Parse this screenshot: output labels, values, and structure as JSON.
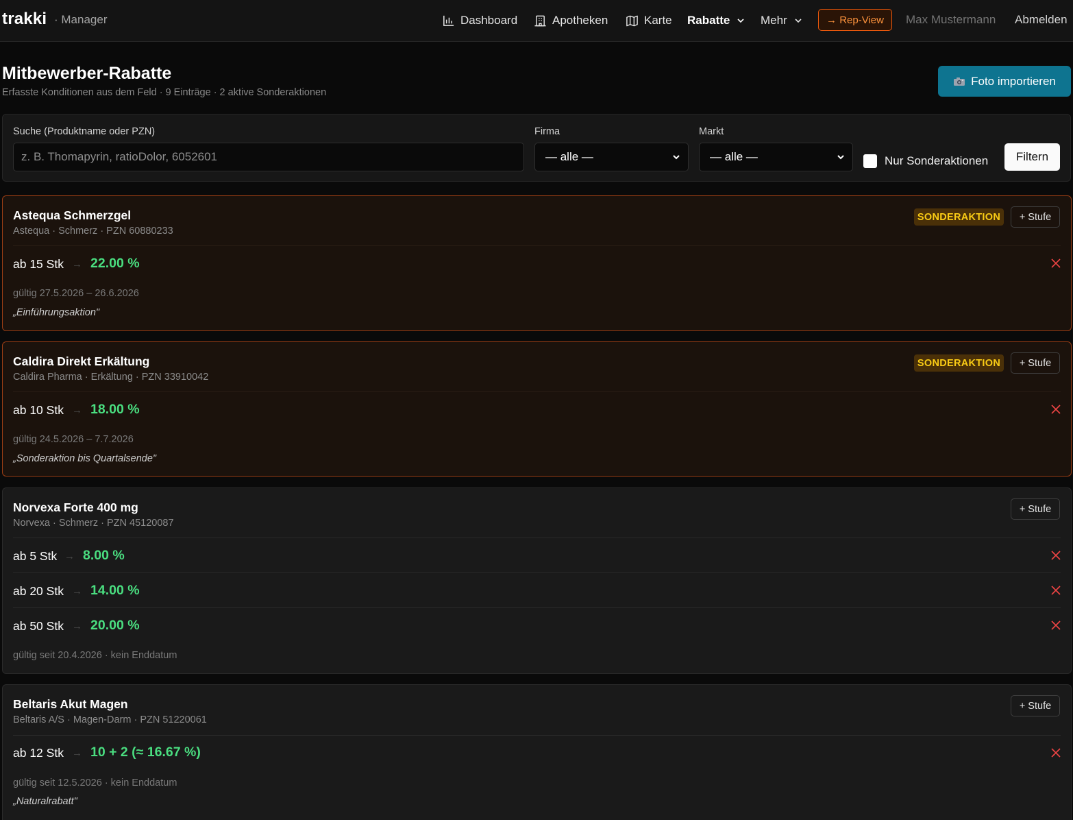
{
  "nav": {
    "brand": "trakki",
    "brand_sub": "· Manager",
    "items": [
      {
        "label": "Dashboard",
        "icon": "bar-chart-icon"
      },
      {
        "label": "Apotheken",
        "icon": "building-icon"
      },
      {
        "label": "Karte",
        "icon": "map-icon"
      },
      {
        "label": "Rabatte",
        "icon": "chevron-down-icon",
        "active": true
      },
      {
        "label": "Mehr",
        "icon": "chevron-down-icon"
      }
    ],
    "rep_view": "→ Rep-View",
    "user": "Max Mustermann",
    "logout": "Abmelden"
  },
  "header": {
    "title": "Mitbewerber-Rabatte",
    "subtitle": "Erfasste Konditionen aus dem Feld · 9 Einträge · 2 aktive Sonderaktionen",
    "import_button": "Foto importieren",
    "import_icon": "camera-icon"
  },
  "filters": {
    "search_label": "Suche (Produktname oder PZN)",
    "search_placeholder": "z. B. Thomapyrin, ratioDolor, 6052601",
    "search_value": "",
    "firma_label": "Firma",
    "firma_value": "— alle —",
    "markt_label": "Markt",
    "markt_value": "— alle —",
    "only_special_label": "Nur Sonderaktionen",
    "only_special_checked": false,
    "filter_button": "Filtern"
  },
  "colors": {
    "accent_teal": "#0e7490",
    "rep_orange": "#ea580c",
    "discount_green": "#4ade80",
    "badge_yellow": "#facc15",
    "delete_red": "#ef4444"
  },
  "cards": [
    {
      "name": "Astequa Schmerzgel",
      "meta": "Astequa · Schmerz · PZN 60880233",
      "special": true,
      "badge": "SONDERAKTION",
      "add_tier": "+ Stufe",
      "tiers": [
        {
          "qty": "ab 15 Stk",
          "arrow": "→",
          "value": "22.00 %"
        }
      ],
      "validity": "gültig 27.5.2026 – 26.6.2026",
      "note": "„Einführungsaktion\""
    },
    {
      "name": "Caldira Direkt Erkältung",
      "meta": "Caldira Pharma · Erkältung · PZN 33910042",
      "special": true,
      "badge": "SONDERAKTION",
      "add_tier": "+ Stufe",
      "tiers": [
        {
          "qty": "ab 10 Stk",
          "arrow": "→",
          "value": "18.00 %"
        }
      ],
      "validity": "gültig 24.5.2026 – 7.7.2026",
      "note": "„Sonderaktion bis Quartalsende\""
    },
    {
      "name": "Norvexa Forte 400 mg",
      "meta": "Norvexa · Schmerz · PZN 45120087",
      "special": false,
      "add_tier": "+ Stufe",
      "tiers": [
        {
          "qty": "ab 5 Stk",
          "arrow": "→",
          "value": "8.00 %"
        },
        {
          "qty": "ab 20 Stk",
          "arrow": "→",
          "value": "14.00 %"
        },
        {
          "qty": "ab 50 Stk",
          "arrow": "→",
          "value": "20.00 %"
        }
      ],
      "validity": "gültig seit 20.4.2026 · kein Enddatum"
    },
    {
      "name": "Beltaris Akut Magen",
      "meta": "Beltaris A/S · Magen-Darm · PZN 51220061",
      "special": false,
      "add_tier": "+ Stufe",
      "tiers": [
        {
          "qty": "ab 12 Stk",
          "arrow": "→",
          "value": "10 + 2 (≈ 16.67 %)"
        }
      ],
      "validity": "gültig seit 12.5.2026 · kein Enddatum",
      "note": "„Naturalrabatt\""
    }
  ]
}
